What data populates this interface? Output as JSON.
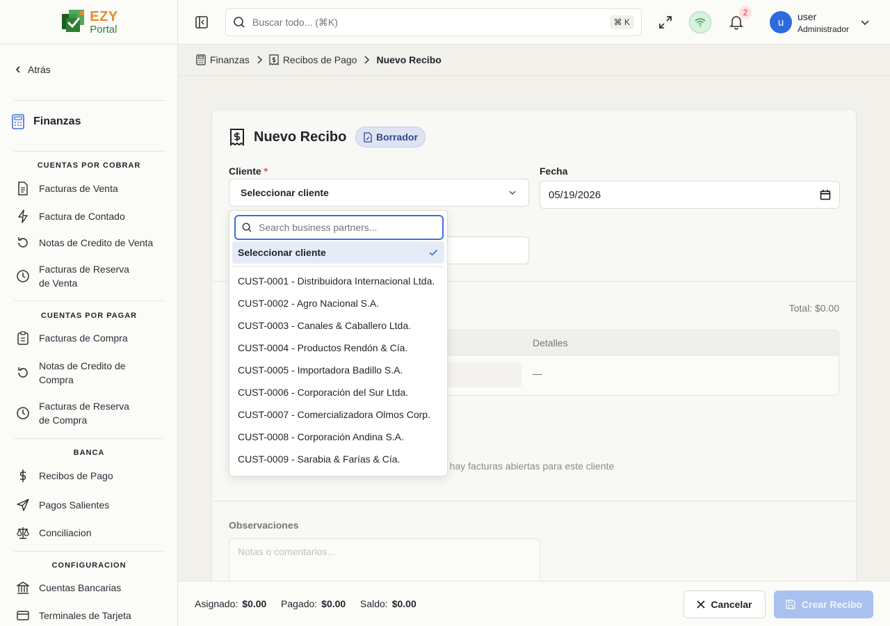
{
  "logo": {
    "brand": "EZY",
    "sub": "Portal"
  },
  "sidebar": {
    "back_label": "Atrás",
    "module_title": "Finanzas",
    "sections": [
      {
        "title": "CUENTAS POR COBRAR",
        "items": [
          {
            "label": "Facturas de Venta",
            "icon": "document-icon"
          },
          {
            "label": "Factura de Contado",
            "icon": "lightning-icon"
          },
          {
            "label": "Notas de Credito de Venta",
            "icon": "refresh-icon"
          },
          {
            "label": "Facturas de Reserva de Venta",
            "icon": "clock-icon"
          }
        ]
      },
      {
        "title": "CUENTAS POR PAGAR",
        "items": [
          {
            "label": "Facturas de Compra",
            "icon": "clipboard-icon"
          },
          {
            "label": "Notas de Credito de Compra",
            "icon": "refresh-icon"
          },
          {
            "label": "Facturas de Reserva de Compra",
            "icon": "clock-icon"
          }
        ]
      },
      {
        "title": "BANCA",
        "items": [
          {
            "label": "Recibos de Pago",
            "icon": "dollar-icon"
          },
          {
            "label": "Pagos Salientes",
            "icon": "send-icon"
          },
          {
            "label": "Conciliacion",
            "icon": "scale-icon"
          }
        ]
      },
      {
        "title": "CONFIGURACION",
        "items": [
          {
            "label": "Cuentas Bancarias",
            "icon": "bank-icon"
          },
          {
            "label": "Terminales de Tarjeta",
            "icon": "card-icon"
          }
        ]
      }
    ]
  },
  "header": {
    "search_placeholder": "Buscar todo... (⌘K)",
    "shortcut": "⌘ K",
    "notification_count": "2",
    "avatar_initial": "u",
    "user_name": "user",
    "user_role": "Administrador"
  },
  "breadcrumb": [
    "Finanzas",
    "Recibos de Pago",
    "Nuevo Recibo"
  ],
  "form": {
    "title": "Nuevo Recibo",
    "status_badge": "Borrador",
    "client_label": "Cliente",
    "required_mark": "*",
    "client_value": "Seleccionar cliente",
    "date_label": "Fecha",
    "date_value": "05/19/2026",
    "total_text": "Total: $0.00",
    "table_header_details": "Detalles",
    "row_dash": "—",
    "empty_message": "No hay facturas abiertas para este cliente",
    "empty_message_visible": "o hay facturas abiertas para este cliente",
    "observations_label": "Observaciones",
    "observations_placeholder": "Notas o comentarios..."
  },
  "dropdown": {
    "search_placeholder": "Search business partners...",
    "selected_option": "Seleccionar cliente",
    "options": [
      "CUST-0001 - Distribuidora Internacional Ltda.",
      "CUST-0002 - Agro Nacional S.A.",
      "CUST-0003 - Canales & Caballero Ltda.",
      "CUST-0004 - Productos Rendón & Cía.",
      "CUST-0005 - Importadora Badillo S.A.",
      "CUST-0006 - Corporación del Sur Ltda.",
      "CUST-0007 - Comercializadora Olmos Corp.",
      "CUST-0008 - Corporación Andina S.A.",
      "CUST-0009 - Sarabia & Farías & Cía."
    ]
  },
  "footer": {
    "assigned_label": "Asignado:",
    "assigned_value": "$0.00",
    "paid_label": "Pagado:",
    "paid_value": "$0.00",
    "balance_label": "Saldo:",
    "balance_value": "$0.00",
    "cancel_label": "Cancelar",
    "create_label": "Crear Recibo"
  },
  "colors": {
    "accent": "#3d6fd9",
    "brand_orange": "#e98b2a",
    "brand_green": "#2e7d32",
    "primary_disabled": "#a9c1ef"
  }
}
